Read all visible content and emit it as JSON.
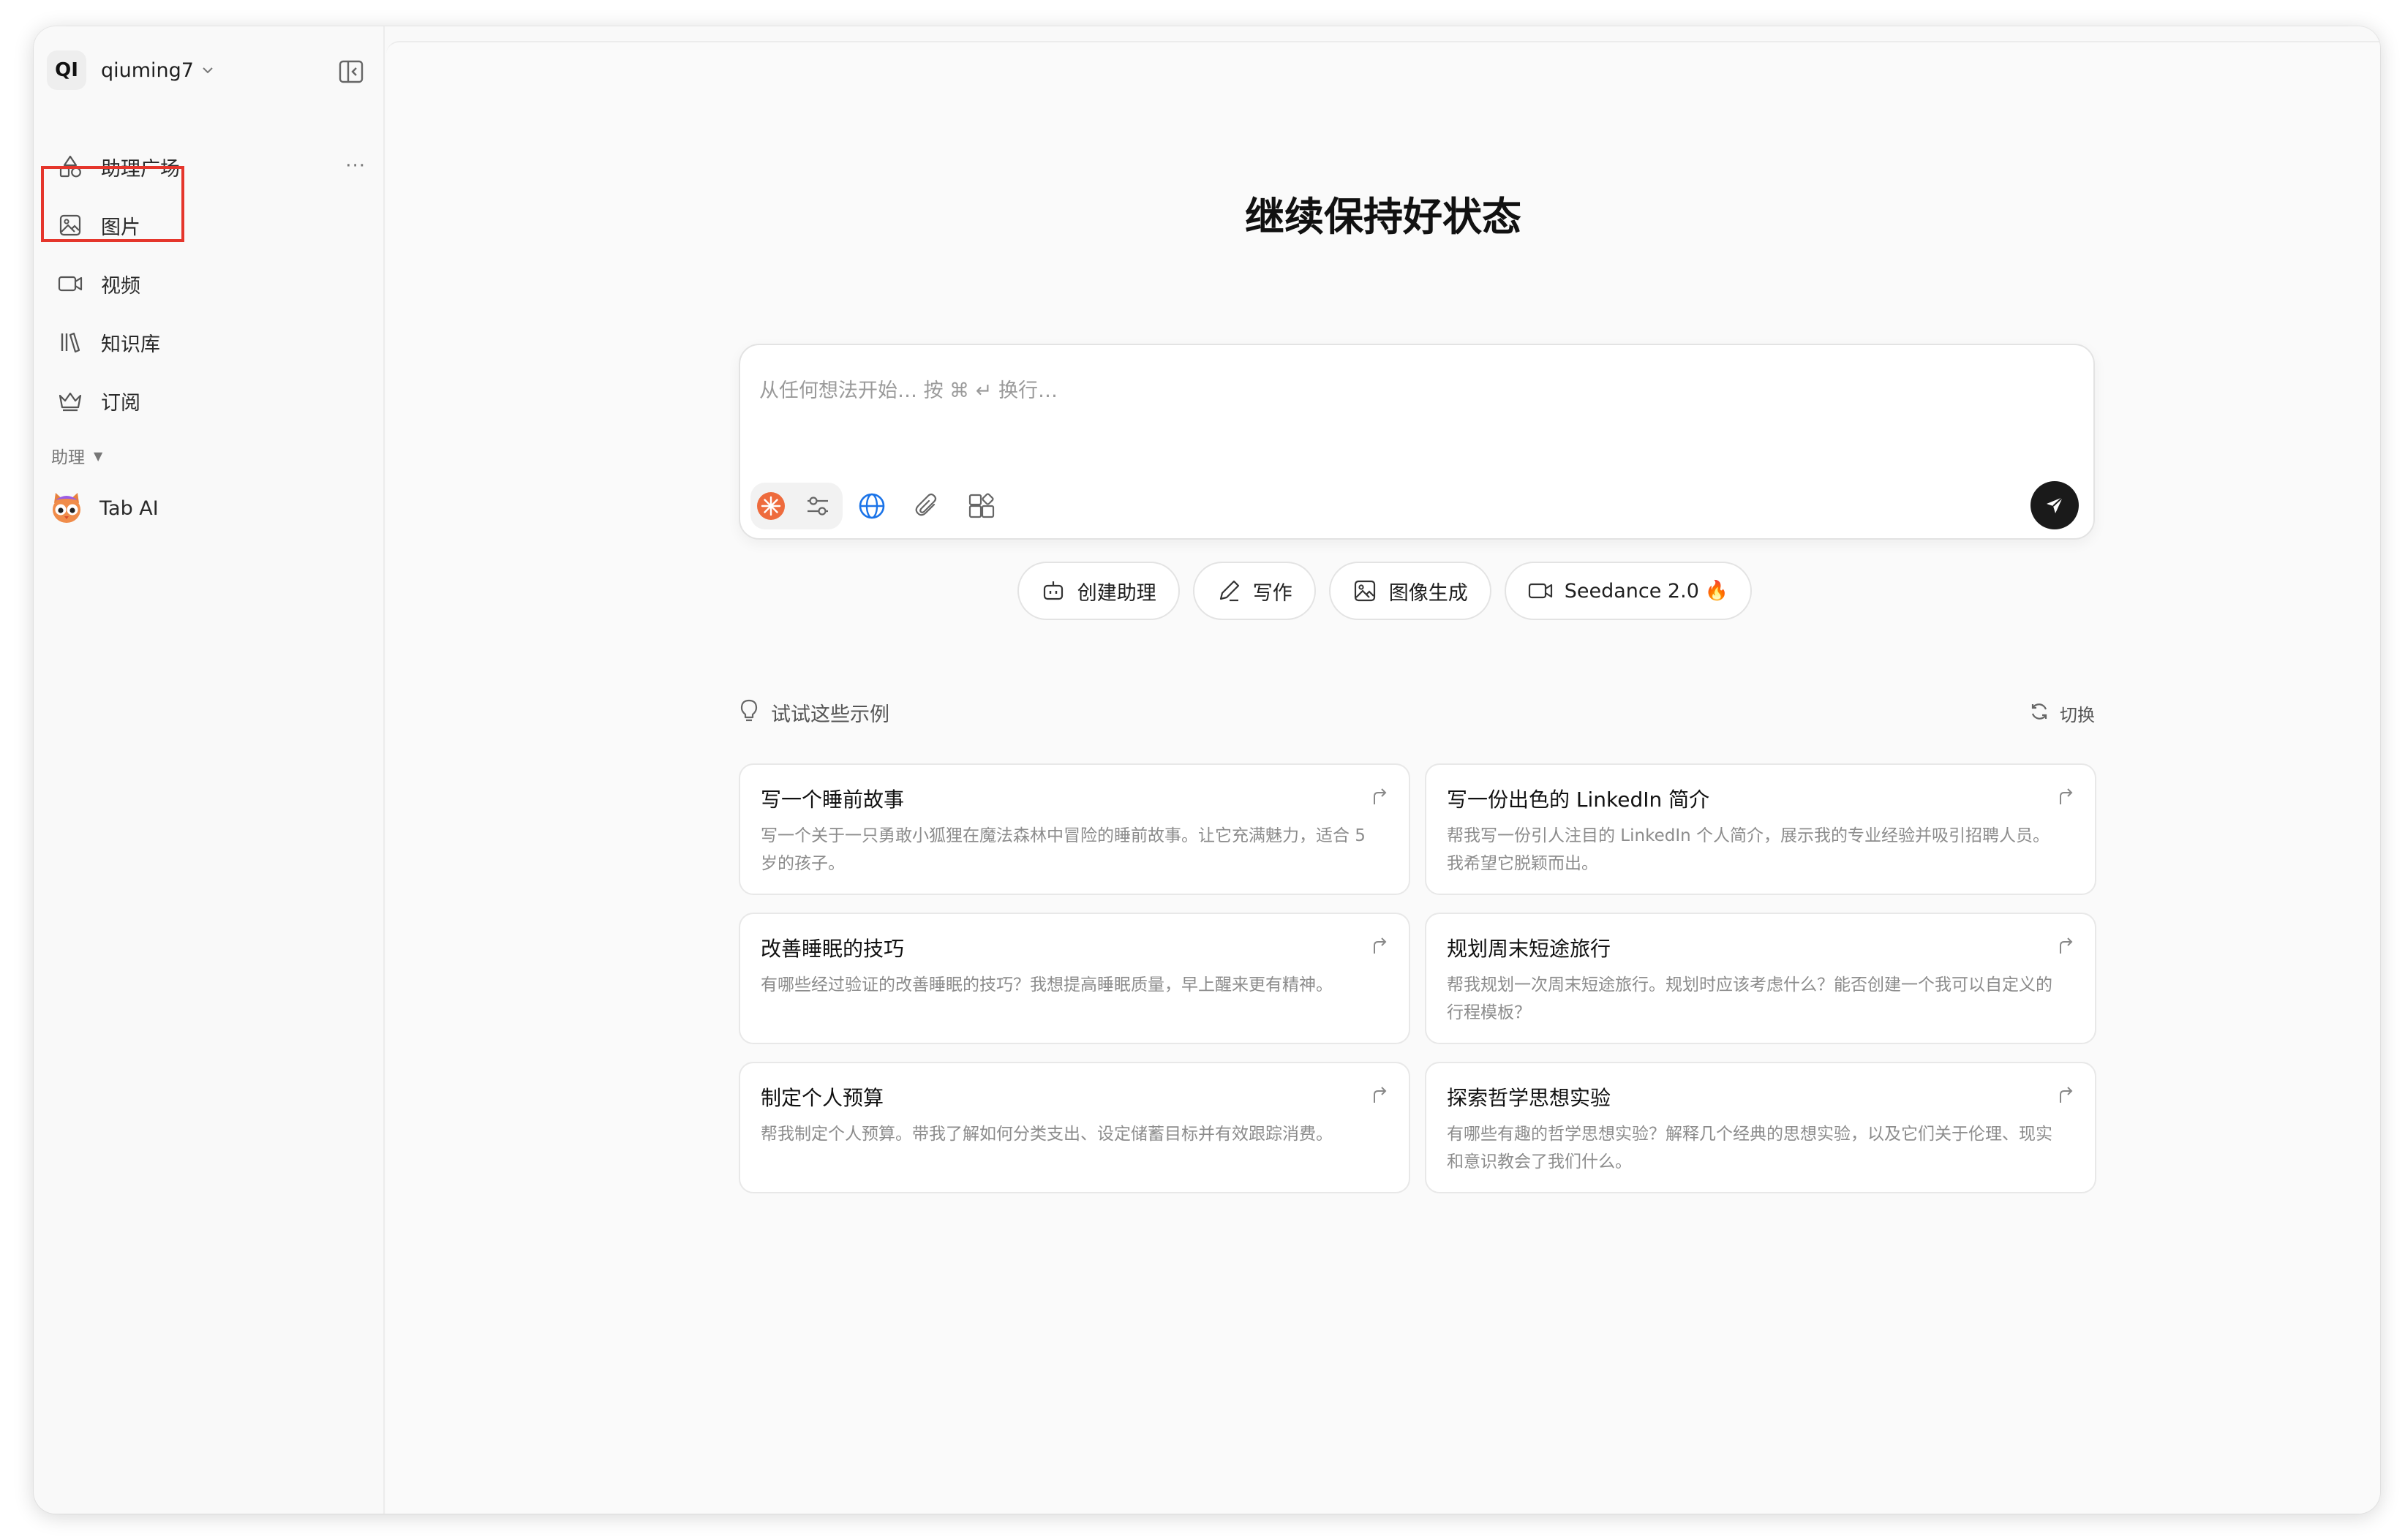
{
  "user": {
    "initials": "QI",
    "name": "qiuming7"
  },
  "sidebar": {
    "items": [
      {
        "label": "助理广场",
        "icon": "shapes-icon"
      },
      {
        "label": "图片",
        "icon": "image-icon"
      },
      {
        "label": "视频",
        "icon": "video-icon"
      },
      {
        "label": "知识库",
        "icon": "library-icon"
      },
      {
        "label": "订阅",
        "icon": "crown-icon"
      }
    ],
    "more": "···",
    "section_label": "助理",
    "assistants": [
      {
        "label": "Tab AI",
        "icon": "owl-avatar-icon"
      }
    ]
  },
  "main": {
    "title": "继续保持好状态",
    "composer": {
      "placeholder": "从任何想法开始… 按 ⌘ ↵ 换行…"
    },
    "chips": [
      {
        "label": "创建助理",
        "icon": "robot-icon"
      },
      {
        "label": "写作",
        "icon": "pen-icon"
      },
      {
        "label": "图像生成",
        "icon": "image-icon"
      },
      {
        "label": "Seedance 2.0",
        "icon": "video-icon",
        "suffix": "🔥"
      }
    ],
    "examples": {
      "label": "试试这些示例",
      "refresh_label": "切换",
      "cards": [
        {
          "title": "写一个睡前故事",
          "desc": "写一个关于一只勇敢小狐狸在魔法森林中冒险的睡前故事。让它充满魅力，适合 5 岁的孩子。"
        },
        {
          "title": "写一份出色的 LinkedIn 简介",
          "desc": "帮我写一份引人注目的 LinkedIn 个人简介，展示我的专业经验并吸引招聘人员。我希望它脱颖而出。"
        },
        {
          "title": "改善睡眠的技巧",
          "desc": "有哪些经过验证的改善睡眠的技巧？我想提高睡眠质量，早上醒来更有精神。"
        },
        {
          "title": "规划周末短途旅行",
          "desc": "帮我规划一次周末短途旅行。规划时应该考虑什么？能否创建一个我可以自定义的行程模板？"
        },
        {
          "title": "制定个人预算",
          "desc": "帮我制定个人预算。带我了解如何分类支出、设定储蓄目标并有效跟踪消费。"
        },
        {
          "title": "探索哲学思想实验",
          "desc": "有哪些有趣的哲学思想实验？解释几个经典的思想实验，以及它们关于伦理、现实和意识教会了我们什么。"
        }
      ]
    }
  },
  "colors": {
    "highlight": "#e5362c",
    "send_button": "#1a1a1a",
    "globe": "#1a73e8",
    "brand_badge": "#ee6b3d"
  }
}
